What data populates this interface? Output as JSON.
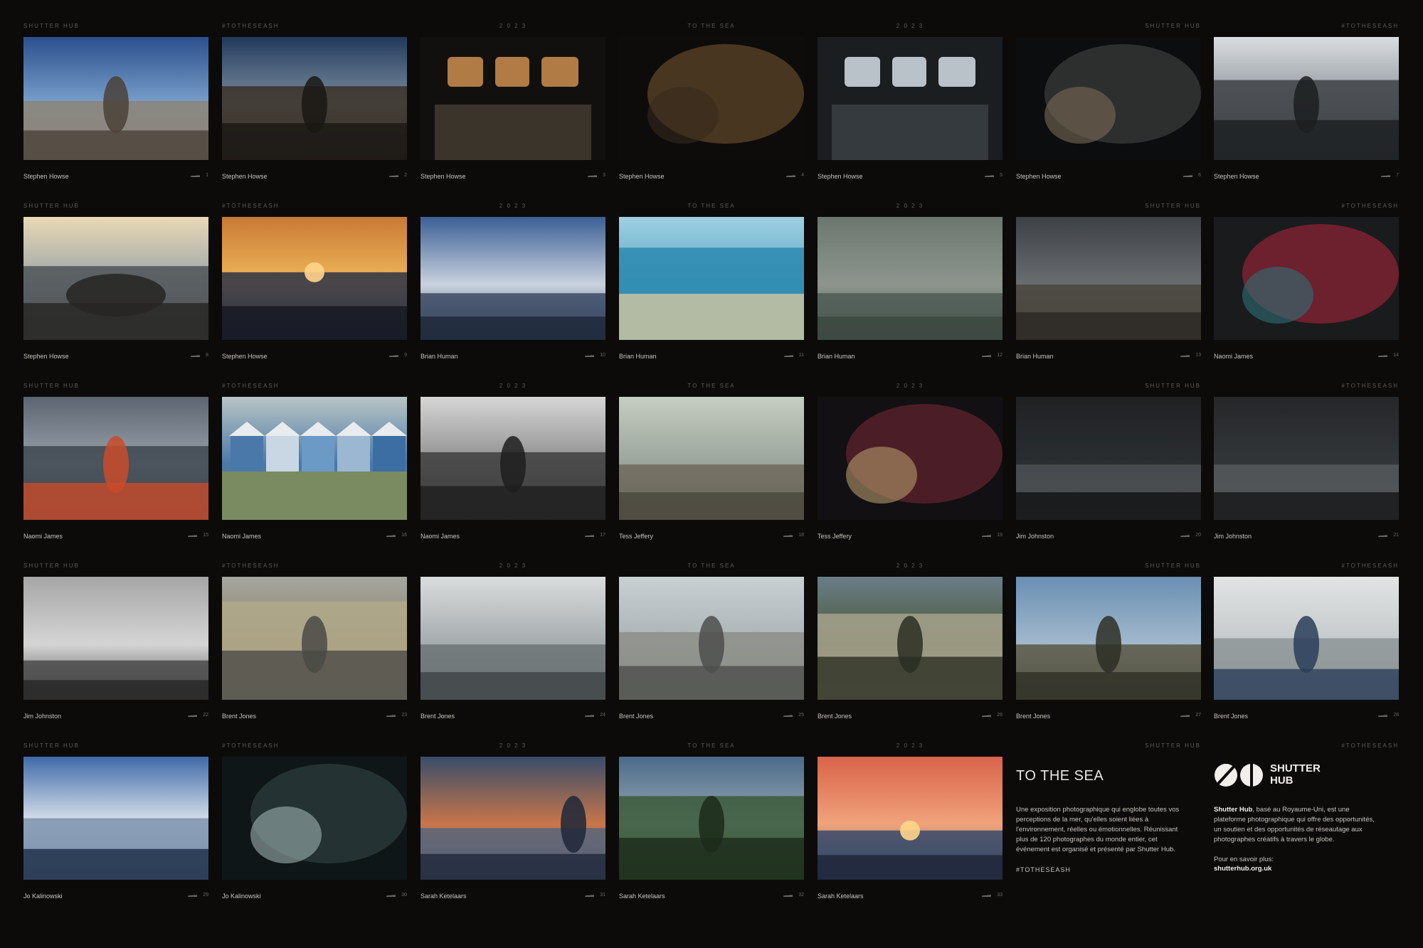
{
  "headers": [
    "SHUTTER HUB",
    "#TOTHESEASH",
    "2 0 2 3",
    "TO THE SEA",
    "2 0 2 3",
    "SHUTTER HUB",
    "#TOTHESEASH"
  ],
  "header_align": [
    "left",
    "left",
    "center",
    "center",
    "center",
    "right",
    "right"
  ],
  "photos": [
    {
      "n": "1",
      "photographer": "Stephen Howse",
      "palette": [
        "#2b4f8d",
        "#7aa1cc",
        "#8d8477",
        "#4a4138"
      ],
      "theme": "shingle"
    },
    {
      "n": "2",
      "photographer": "Stephen Howse",
      "palette": [
        "#21395a",
        "#7e8fa3",
        "#3a3026",
        "#1a1714"
      ],
      "theme": "deck"
    },
    {
      "n": "3",
      "photographer": "Stephen Howse",
      "palette": [
        "#1c1a17",
        "#b07b45",
        "#3b342b",
        "#11100e"
      ],
      "theme": "cabin"
    },
    {
      "n": "4",
      "photographer": "Stephen Howse",
      "palette": [
        "#1a150f",
        "#7a5a33",
        "#362a1d",
        "#0e0c0a"
      ],
      "theme": "shadow"
    },
    {
      "n": "5",
      "photographer": "Stephen Howse",
      "palette": [
        "#5d6b78",
        "#b9c2c9",
        "#353a3e",
        "#1b1e21"
      ],
      "theme": "wheelhouse"
    },
    {
      "n": "6",
      "photographer": "Stephen Howse",
      "palette": [
        "#15191b",
        "#4a4c4b",
        "#7a6a55",
        "#0b0d0e"
      ],
      "theme": "dark"
    },
    {
      "n": "7",
      "photographer": "Stephen Howse",
      "palette": [
        "#d9dde0",
        "#8b9298",
        "#3e4247",
        "#1c1e20"
      ],
      "theme": "backlit"
    },
    {
      "n": "8",
      "photographer": "Stephen Howse",
      "palette": [
        "#e9d9b6",
        "#9aa3a8",
        "#4f5458",
        "#262522"
      ],
      "theme": "boat"
    },
    {
      "n": "9",
      "photographer": "Stephen Howse",
      "palette": [
        "#c97a35",
        "#f0b85a",
        "#2c3146",
        "#141621"
      ],
      "theme": "sunset"
    },
    {
      "n": "10",
      "photographer": "Brian Human",
      "palette": [
        "#3c5f95",
        "#c9d2de",
        "#3b4a64",
        "#1c2637"
      ],
      "theme": "clouds"
    },
    {
      "n": "11",
      "photographer": "Brian Human",
      "palette": [
        "#9fd0e3",
        "#5aa7c4",
        "#2d89b0",
        "#d5c7a0"
      ],
      "theme": "shore"
    },
    {
      "n": "12",
      "photographer": "Brian Human",
      "palette": [
        "#6c7770",
        "#8d958d",
        "#4e5c55",
        "#3a463f"
      ],
      "theme": "rain"
    },
    {
      "n": "13",
      "photographer": "Brian Human",
      "palette": [
        "#3c4146",
        "#6a6d70",
        "#4a4740",
        "#2a2824"
      ],
      "theme": "beach"
    },
    {
      "n": "14",
      "photographer": "Naomi James",
      "palette": [
        "#2a2b2f",
        "#b3253a",
        "#2f6f74",
        "#1a1b1d"
      ],
      "theme": "rope"
    },
    {
      "n": "15",
      "photographer": "Naomi James",
      "palette": [
        "#5c6571",
        "#9aa3ab",
        "#3e4650",
        "#c94b2a"
      ],
      "theme": "lifeboat"
    },
    {
      "n": "16",
      "photographer": "Naomi James",
      "palette": [
        "#b9c5c4",
        "#4a78a8",
        "#7a8b62",
        "#3a4a2a"
      ],
      "theme": "huts"
    },
    {
      "n": "17",
      "photographer": "Naomi James",
      "palette": [
        "#d6d6d6",
        "#8d8d8d",
        "#3e3e3e",
        "#1e1e1e"
      ],
      "theme": "pier"
    },
    {
      "n": "18",
      "photographer": "Tess Jeffery",
      "palette": [
        "#c6cdc2",
        "#9aa49a",
        "#6e6a5d",
        "#4a463c"
      ],
      "theme": "town"
    },
    {
      "n": "19",
      "photographer": "Tess Jeffery",
      "palette": [
        "#2a1e22",
        "#7a2a38",
        "#b49a6a",
        "#121012"
      ],
      "theme": "toys"
    },
    {
      "n": "20",
      "photographer": "Jim Johnston",
      "palette": [
        "#1f2123",
        "#2b2e31",
        "#4c5053",
        "#0f1011"
      ],
      "theme": "storm"
    },
    {
      "n": "21",
      "photographer": "Jim Johnston",
      "palette": [
        "#252729",
        "#33363a",
        "#55585b",
        "#141516"
      ],
      "theme": "storm"
    },
    {
      "n": "22",
      "photographer": "Jim Johnston",
      "palette": [
        "#a6a6a6",
        "#d5d5d5",
        "#4a4a4a",
        "#262626"
      ],
      "theme": "clouds-bw"
    },
    {
      "n": "23",
      "photographer": "Brent Jones",
      "palette": [
        "#a5a79f",
        "#8a8069",
        "#b2a98a",
        "#4a4a46"
      ],
      "theme": "tidepools"
    },
    {
      "n": "24",
      "photographer": "Brent Jones",
      "palette": [
        "#d9dcdc",
        "#a5abad",
        "#6d7476",
        "#3e4446"
      ],
      "theme": "calm"
    },
    {
      "n": "25",
      "photographer": "Brent Jones",
      "palette": [
        "#c9d0d3",
        "#a9b2b6",
        "#8d8f87",
        "#4d4f4c"
      ],
      "theme": "port"
    },
    {
      "n": "26",
      "photographer": "Brent Jones",
      "palette": [
        "#6a7d88",
        "#4a5a3a",
        "#a7a28c",
        "#2a2e22"
      ],
      "theme": "arch"
    },
    {
      "n": "27",
      "photographer": "Brent Jones",
      "palette": [
        "#6a8fb3",
        "#a2b9cc",
        "#5a5846",
        "#2e2f25"
      ],
      "theme": "rocks"
    },
    {
      "n": "28",
      "photographer": "Brent Jones",
      "palette": [
        "#e2e4e4",
        "#c3c8ca",
        "#8d9597",
        "#2a3d5a"
      ],
      "theme": "paddle"
    },
    {
      "n": "29",
      "photographer": "Jo Kalinowski",
      "palette": [
        "#3f6aa8",
        "#dfe6ee",
        "#7c92ad",
        "#1a2a44"
      ],
      "theme": "reflect"
    },
    {
      "n": "30",
      "photographer": "Jo Kalinowski",
      "palette": [
        "#1f2b2e",
        "#394a4d",
        "#9fb0b0",
        "#0f1617"
      ],
      "theme": "waves"
    },
    {
      "n": "31",
      "photographer": "Sarah Ketelaars",
      "palette": [
        "#384d6a",
        "#c9764a",
        "#58657a",
        "#1e2738"
      ],
      "theme": "figure"
    },
    {
      "n": "32",
      "photographer": "Sarah Ketelaars",
      "palette": [
        "#4b6a8a",
        "#98a9b3",
        "#3a5a3a",
        "#1c2a1a"
      ],
      "theme": "swimmer"
    },
    {
      "n": "33",
      "photographer": "Sarah Ketelaars",
      "palette": [
        "#d9634a",
        "#f0a37a",
        "#374a6a",
        "#1d2336"
      ],
      "theme": "sky"
    }
  ],
  "info": {
    "title": "TO THE SEA",
    "body": "Une exposition photographique qui englobe toutes vos perceptions de la mer, qu'elles soient liées à l'environnement, réelles ou émotionnelles. Réunissant plus de 120 photographes du monde entier, cet événement est organisé et présenté par Shutter Hub.",
    "hashtag": "#TOTHESEASH"
  },
  "about": {
    "logo_line1": "SHUTTER",
    "logo_line2": "HUB",
    "brand": "Shutter Hub",
    "text": ", basé au Royaume-Uni, est une plateforme photographique qui offre des opportunités, un soutien et des opportunités de réseautage aux photographes créatifs à travers le globe.",
    "more_label": "Pour en savoir plus:",
    "url": "shutterhub.org.uk"
  }
}
